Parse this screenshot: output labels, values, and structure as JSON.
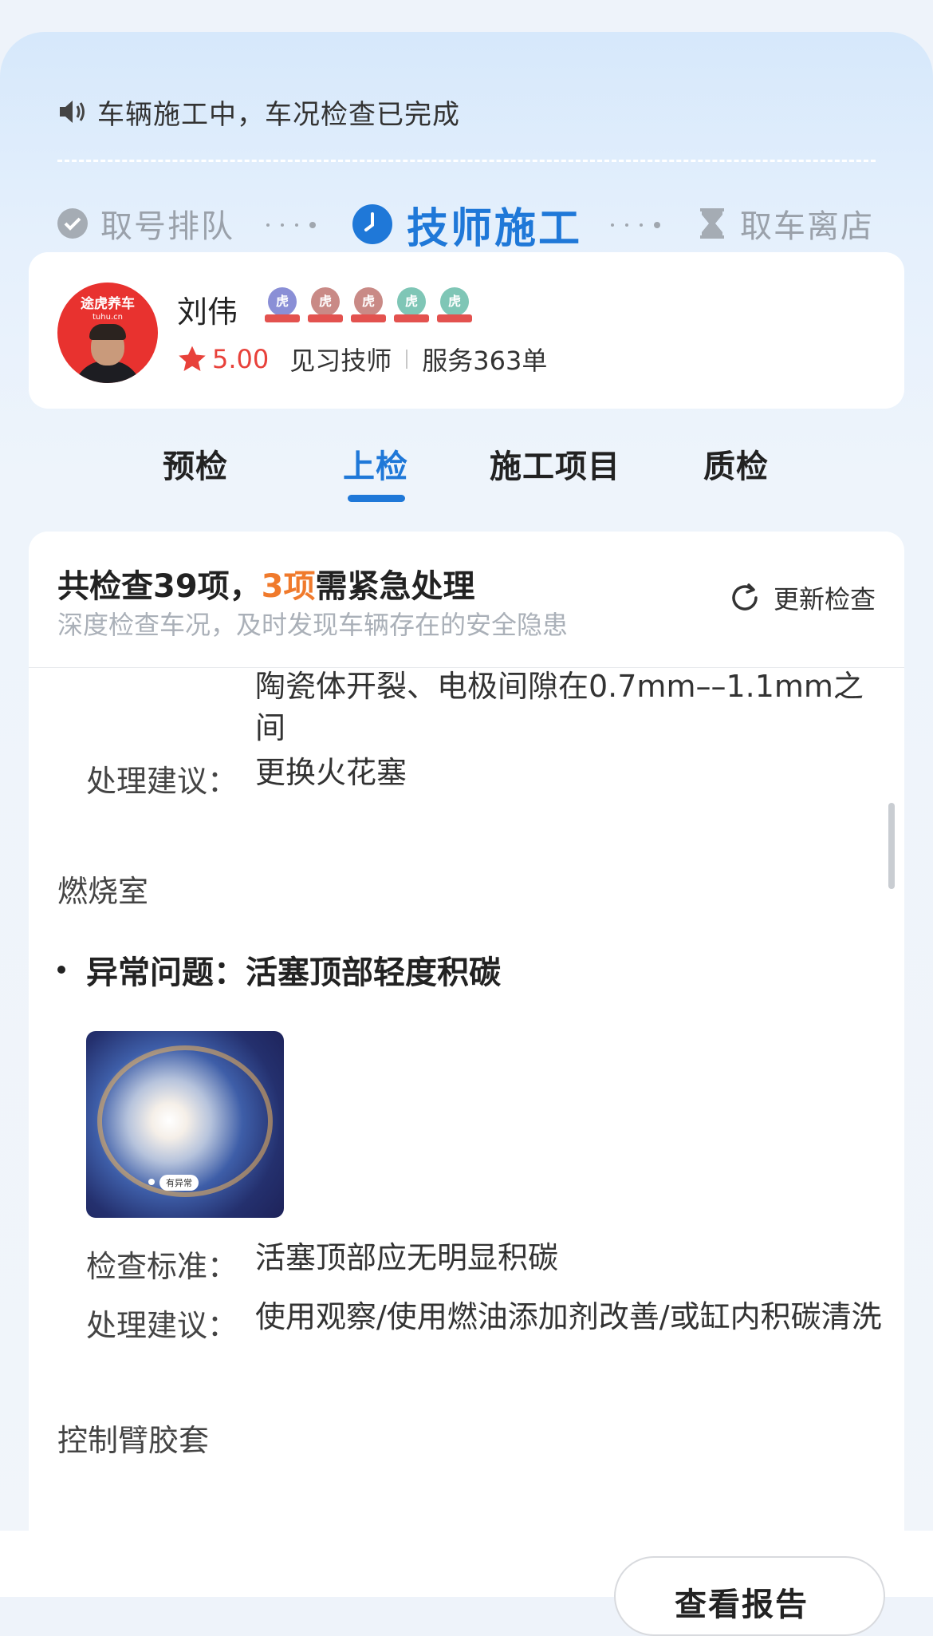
{
  "notice": {
    "icon": "speaker-icon",
    "text": "车辆施工中，车况检查已完成"
  },
  "steps": [
    {
      "label": "取号排队",
      "icon": "check-circle-icon",
      "state": "done"
    },
    {
      "label": "技师施工",
      "icon": "clock-icon",
      "state": "active"
    },
    {
      "label": "取车离店",
      "icon": "hourglass-icon",
      "state": "pending"
    }
  ],
  "technician": {
    "avatar_brand": "途虎养车",
    "avatar_brand_sub": "tuhu.cn",
    "name": "刘伟",
    "badges": [
      {
        "char": "虎",
        "color": "#8a8fd6"
      },
      {
        "char": "虎",
        "color": "#c98a86"
      },
      {
        "char": "虎",
        "color": "#c98a86"
      },
      {
        "char": "虎",
        "color": "#7fc6b6"
      },
      {
        "char": "虎",
        "color": "#7fc6b6"
      }
    ],
    "rating": "5.00",
    "level": "见习技师",
    "service": "服务363单"
  },
  "tabs": [
    {
      "label": "预检",
      "active": false
    },
    {
      "label": "上检",
      "active": true
    },
    {
      "label": "施工项目",
      "active": false
    },
    {
      "label": "质检",
      "active": false
    }
  ],
  "summary": {
    "title_prefix": "共检查39项，",
    "title_highlight": "3项",
    "title_suffix": "需紧急处理",
    "subtitle": "深度检查车况，及时发现车辆存在的安全隐患",
    "refresh_label": "更新检查"
  },
  "details": {
    "spark_plug_standard_tail": "陶瓷体开裂、电极间隙在0.7mm––1.1mm之间",
    "spark_plug_advice_label": "处理建议：",
    "spark_plug_advice": "更换火花塞",
    "combustion_section": "燃烧室",
    "issue_label": "异常问题：活塞顶部轻度积碳",
    "photo_tag": "有异常",
    "standard_label": "检查标准：",
    "standard_value": "活塞顶部应无明显积碳",
    "advice_label": "处理建议：",
    "advice_value": "使用观察/使用燃油添加剂改善/或缸内积碳清洗",
    "next_section": "控制臂胶套"
  },
  "report_button": "查看报告",
  "colors": {
    "accent": "#1f78d8",
    "warning": "#f07a2c",
    "rating": "#e8413a"
  }
}
